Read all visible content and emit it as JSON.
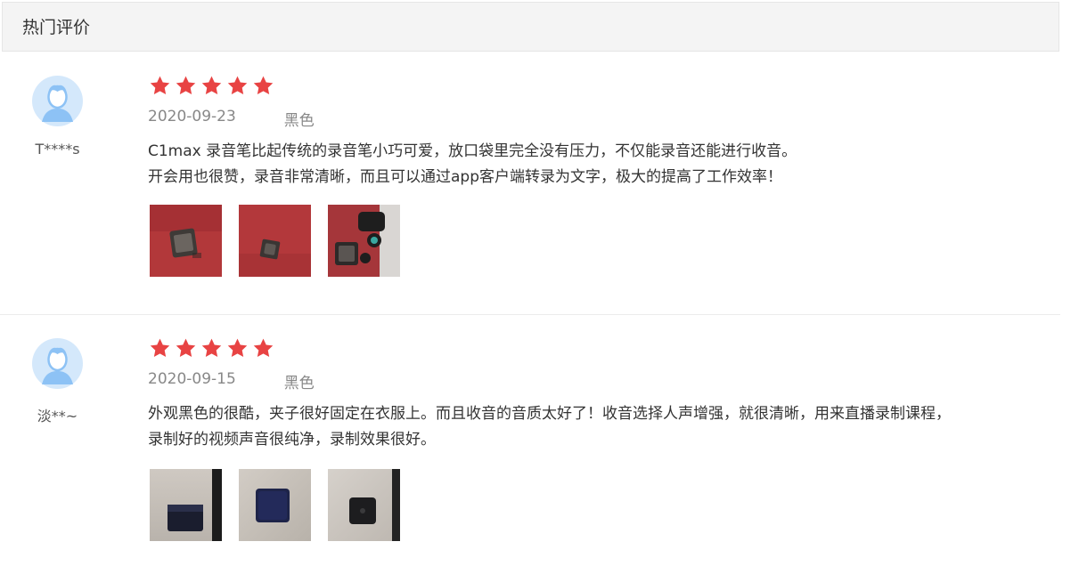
{
  "section": {
    "title": "热门评价"
  },
  "reviews": [
    {
      "username": "T****s",
      "rating": 5,
      "date": "2020-09-23",
      "color": "黑色",
      "content": "C1max 录音笔比起传统的录音笔小巧可爱，放口袋里完全没有压力，不仅能录音还能进行收音。\n开会用也很赞，录音非常清晰，而且可以通过app客户端转录为文字，极大的提高了工作效率！",
      "photos": [
        "photo-device-on-red",
        "photo-device-on-red-2",
        "photo-device-with-earbuds"
      ]
    },
    {
      "username": "淡**~",
      "rating": 5,
      "date": "2020-09-15",
      "color": "黑色",
      "content": "外观黑色的很酷，夹子很好固定在衣服上。而且收音的音质太好了！收音选择人声增强，就很清晰，用来直播录制课程，\n录制好的视频声音很纯净，录制效果很好。",
      "photos": [
        "photo-device-side",
        "photo-device-front",
        "photo-device-back"
      ]
    }
  ],
  "colors": {
    "star": "#e84343",
    "avatar_bg": "#d4e8fb",
    "avatar_fg": "#8dc2f5"
  },
  "icons": {
    "star": "star-icon",
    "avatar": "user-avatar-icon"
  }
}
